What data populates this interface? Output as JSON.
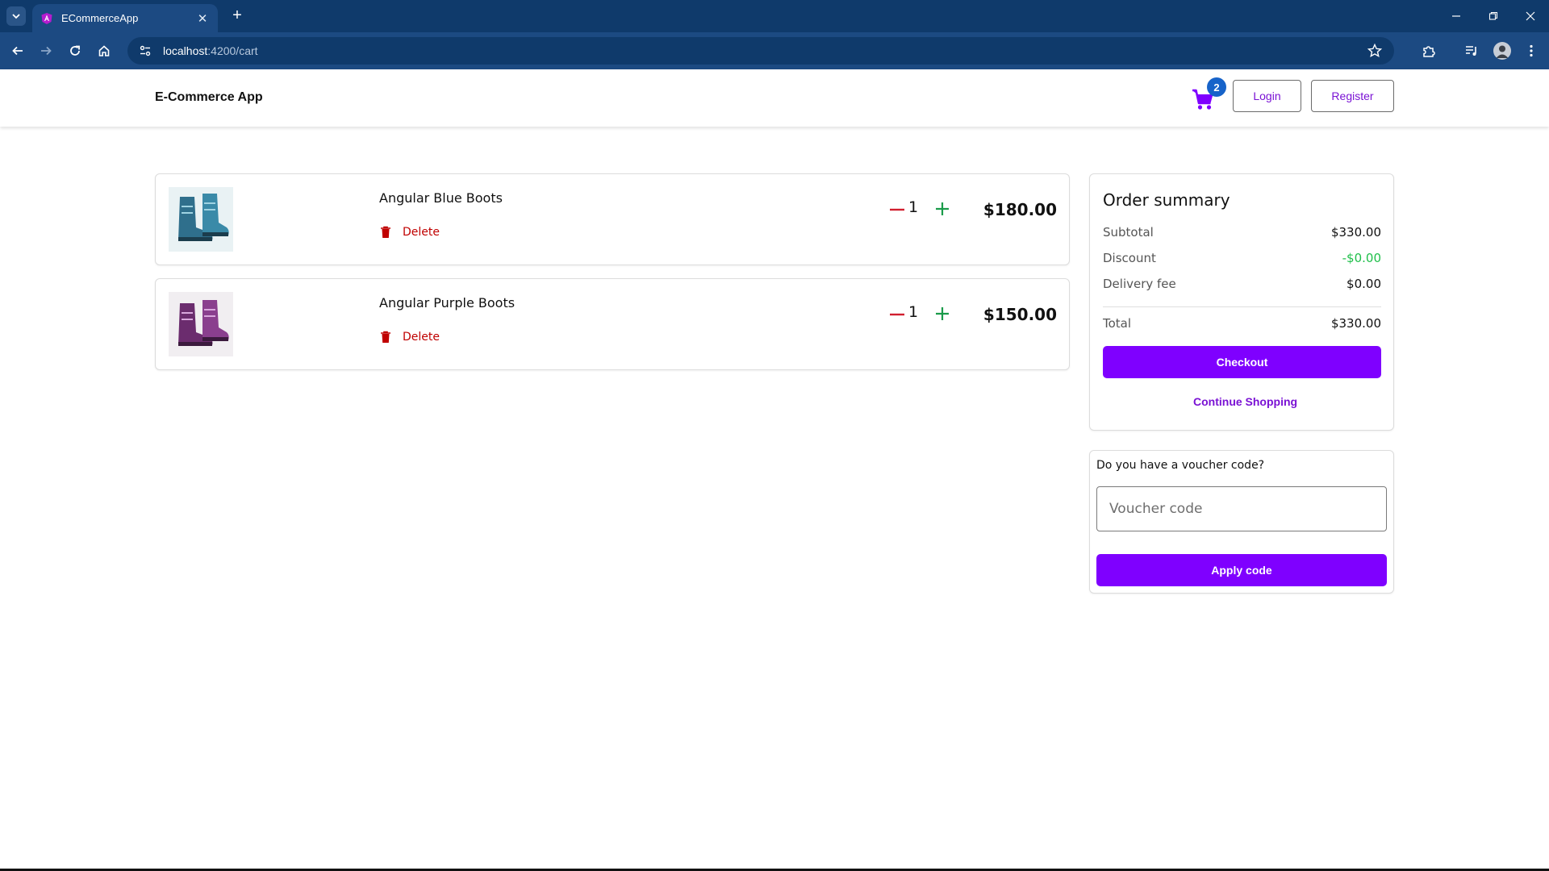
{
  "browser": {
    "tab_title": "ECommerceApp",
    "url_host": "localhost",
    "url_path": ":4200/cart"
  },
  "header": {
    "brand": "E-Commerce App",
    "cart_count": "2",
    "login_label": "Login",
    "register_label": "Register"
  },
  "cart": {
    "items": [
      {
        "name": "Angular Blue Boots",
        "delete_label": "Delete",
        "quantity": "1",
        "price": "$180.00",
        "color": "#2f6f8c"
      },
      {
        "name": "Angular Purple Boots",
        "delete_label": "Delete",
        "quantity": "1",
        "price": "$150.00",
        "color": "#6b2c6e"
      }
    ]
  },
  "summary": {
    "title": "Order summary",
    "subtotal_label": "Subtotal",
    "subtotal_value": "$330.00",
    "discount_label": "Discount",
    "discount_value": "-$0.00",
    "delivery_label": "Delivery fee",
    "delivery_value": "$0.00",
    "total_label": "Total",
    "total_value": "$330.00",
    "checkout_label": "Checkout",
    "continue_label": "Continue Shopping"
  },
  "voucher": {
    "question": "Do you have a voucher code?",
    "placeholder": "Voucher code",
    "value": "",
    "apply_label": "Apply code"
  },
  "colors": {
    "accent": "#7f00ff",
    "delete": "#c00000",
    "plus": "#1a9b4a",
    "minus": "#d11f2f",
    "badge": "#1763c9",
    "browser_frame": "#0f3a6b"
  }
}
